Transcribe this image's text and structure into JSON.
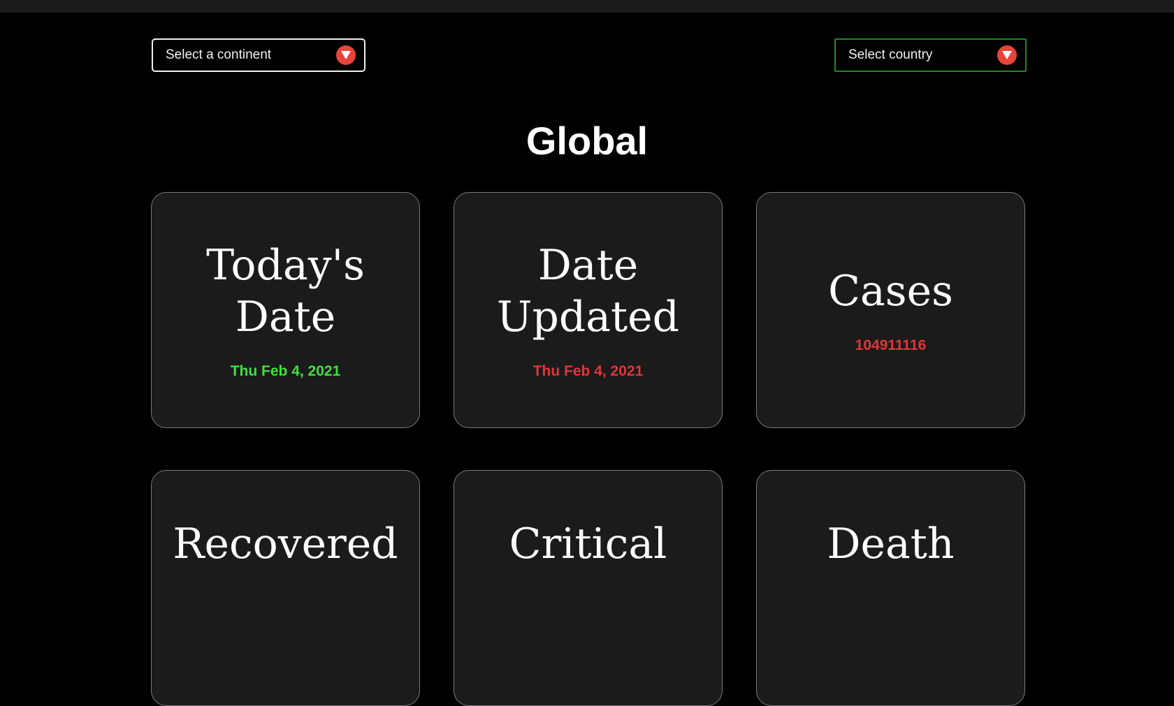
{
  "selects": {
    "continent": {
      "label": "Select a continent"
    },
    "country": {
      "label": "Select country"
    }
  },
  "page": {
    "title": "Global"
  },
  "colors": {
    "accent_green": "#3ee13e",
    "accent_red": "#e0363a",
    "dropdown_badge": "#e8443a",
    "country_border": "#1f8a1f"
  },
  "cards": [
    {
      "title": "Today's Date",
      "title_lines": [
        "Today's",
        "Date"
      ],
      "value": "Thu Feb 4, 2021",
      "value_color": "#3ee13e"
    },
    {
      "title": "Date Updated",
      "title_lines": [
        "Date",
        "Updated"
      ],
      "value": "Thu Feb 4, 2021",
      "value_color": "#e0363a"
    },
    {
      "title": "Cases",
      "title_lines": [
        "Cases"
      ],
      "value": "104911116",
      "value_color": "#e0363a"
    },
    {
      "title": "Recovered",
      "title_lines": [
        "Recovered"
      ]
    },
    {
      "title": "Critical",
      "title_lines": [
        "Critical"
      ]
    },
    {
      "title": "Death",
      "title_lines": [
        "Death"
      ]
    }
  ],
  "icons": {
    "dropdown": "chevron-down-icon"
  }
}
